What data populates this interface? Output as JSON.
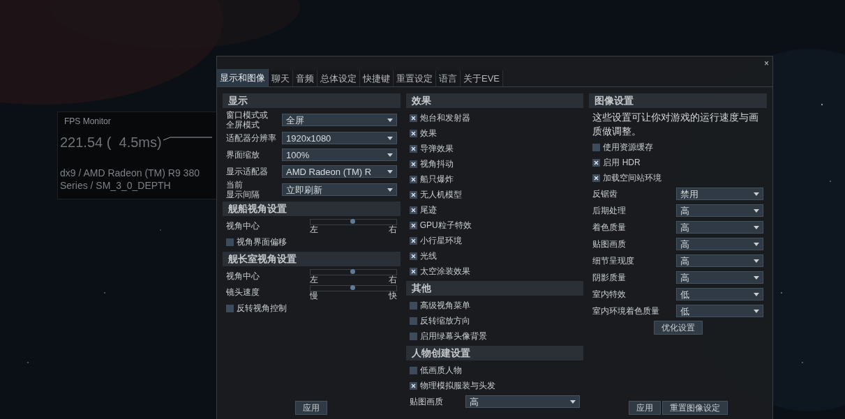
{
  "fps_monitor": {
    "title": "FPS Monitor",
    "reading": "221.54 (  4.5ms)",
    "adapter": "dx9 / AMD Radeon (TM) R9 380 Series / SM_3_0_DEPTH"
  },
  "window": {
    "close": "×"
  },
  "tabs": [
    {
      "label": "显示和图像",
      "selected": true
    },
    {
      "label": "聊天",
      "selected": false
    },
    {
      "label": "音频",
      "selected": false
    },
    {
      "label": "总体设定",
      "selected": false
    },
    {
      "label": "快捷键",
      "selected": false
    },
    {
      "label": "重置设定",
      "selected": false
    },
    {
      "label": "语言",
      "selected": false
    },
    {
      "label": "关于EVE",
      "selected": false
    }
  ],
  "columns": [
    {
      "sections": [
        {
          "title": "显示",
          "items": [
            {
              "kind": "select",
              "label_lines": [
                "窗口模式或",
                "全屏模式"
              ],
              "value": "全屏"
            },
            {
              "kind": "select",
              "label": "适配器分辨率",
              "value": "1920x1080"
            },
            {
              "kind": "select",
              "label": "界面缩放",
              "value": "100%"
            },
            {
              "kind": "select",
              "label": "显示适配器",
              "value": "AMD Radeon (TM) R"
            },
            {
              "kind": "select",
              "label_lines": [
                "当前",
                "显示间隔"
              ],
              "value": "立即刷新"
            }
          ]
        },
        {
          "title": "舰船视角设置",
          "items": [
            {
              "kind": "slider",
              "label": "视角中心",
              "min": "左",
              "max": "右",
              "level": 0.5
            },
            {
              "kind": "checkbox",
              "label": "视角界面偏移",
              "checked": false
            }
          ]
        },
        {
          "title": "舰长室视角设置",
          "items": [
            {
              "kind": "slider",
              "label": "视角中心",
              "min": "左",
              "max": "右",
              "level": 0.5
            },
            {
              "kind": "slider",
              "label": "镜头速度",
              "min": "慢",
              "max": "快",
              "level": 0.5
            },
            {
              "kind": "checkbox",
              "label": "反转视角控制",
              "checked": false
            }
          ]
        }
      ],
      "buttons": [
        "应用"
      ]
    },
    {
      "sections": [
        {
          "title": "效果",
          "items": [
            {
              "kind": "checkbox",
              "label": "炮台和发射器",
              "checked": true
            },
            {
              "kind": "checkbox",
              "label": "效果",
              "checked": true
            },
            {
              "kind": "checkbox",
              "label": "导弹效果",
              "checked": true
            },
            {
              "kind": "checkbox",
              "label": "视角抖动",
              "checked": true
            },
            {
              "kind": "checkbox",
              "label": "船只爆炸",
              "checked": true
            },
            {
              "kind": "checkbox",
              "label": "无人机模型",
              "checked": true
            },
            {
              "kind": "checkbox",
              "label": "尾迹",
              "checked": true
            },
            {
              "kind": "checkbox",
              "label": "GPU粒子特效",
              "checked": true
            },
            {
              "kind": "checkbox",
              "label": "小行星环境",
              "checked": true
            },
            {
              "kind": "checkbox",
              "label": "光线",
              "checked": true
            },
            {
              "kind": "checkbox",
              "label": "太空涂装效果",
              "checked": true
            }
          ]
        },
        {
          "title": "其他",
          "items": [
            {
              "kind": "checkbox",
              "label": "高级视角菜单",
              "checked": false
            },
            {
              "kind": "checkbox",
              "label": "反转缩放方向",
              "checked": false
            },
            {
              "kind": "checkbox",
              "label": "启用绿幕头像背景",
              "checked": false
            }
          ]
        },
        {
          "title": "人物创建设置",
          "items": [
            {
              "kind": "checkbox",
              "label": "低画质人物",
              "checked": false
            },
            {
              "kind": "checkbox",
              "label": "物理模拟服装与头发",
              "checked": true
            },
            {
              "kind": "select",
              "label": "贴图画质",
              "value": "高"
            }
          ]
        }
      ]
    },
    {
      "sections": [
        {
          "title": "图像设置",
          "items": [
            {
              "kind": "text",
              "label": "这些设置可让你对游戏的运行速度与画质做调整。"
            },
            {
              "kind": "checkbox",
              "label": "使用资源缓存",
              "checked": false
            },
            {
              "kind": "checkbox",
              "label": "启用 HDR",
              "checked": true
            },
            {
              "kind": "checkbox",
              "label": "加载空间站环境",
              "checked": true
            },
            {
              "kind": "select",
              "label": "反锯齿",
              "value": "禁用"
            },
            {
              "kind": "select",
              "label": "后期处理",
              "value": "高"
            },
            {
              "kind": "select",
              "label": "着色质量",
              "value": "高"
            },
            {
              "kind": "select",
              "label": "贴图画质",
              "value": "高"
            },
            {
              "kind": "select",
              "label": "细节呈现度",
              "value": "高"
            },
            {
              "kind": "select",
              "label": "阴影质量",
              "value": "高"
            },
            {
              "kind": "select",
              "label": "室内特效",
              "value": "低"
            },
            {
              "kind": "select",
              "label": "室内环境着色质量",
              "value": "低"
            },
            {
              "kind": "button",
              "label": "优化设置"
            }
          ]
        }
      ],
      "buttons": [
        "应用",
        "重置图像设定"
      ]
    }
  ]
}
